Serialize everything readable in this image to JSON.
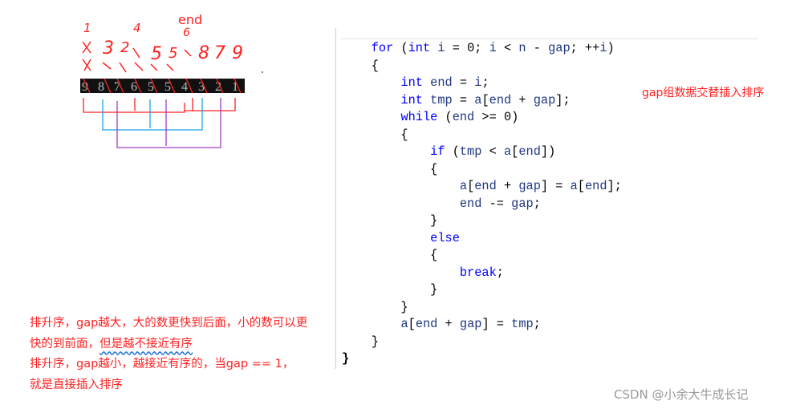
{
  "sketch": {
    "end_label": "end",
    "top_marks": [
      "1",
      "4",
      "6"
    ],
    "row1": [
      "3",
      "2",
      "5",
      "5",
      "8",
      "7",
      "9"
    ],
    "array": [
      "9",
      "8",
      "7",
      "6",
      "5",
      "5",
      "4",
      "3",
      "2",
      "1"
    ],
    "colors": {
      "red": "#ff2020",
      "blue": "#1aa3e8",
      "purple": "#a040c0"
    }
  },
  "code": {
    "lines": [
      "for (int i = 0; i < n - gap; ++i)",
      "{",
      "    int end = i;",
      "    int tmp = a[end + gap];",
      "    while (end >= 0)",
      "    {",
      "        if (tmp < a[end])",
      "        {",
      "            a[end + gap] = a[end];",
      "            end -= gap;",
      "        }",
      "        else",
      "        {",
      "            break;",
      "        }",
      "    }",
      "    a[end + gap] = tmp;",
      "}"
    ],
    "closing": "}"
  },
  "annotation": "gap组数据交替插入排序",
  "notes": {
    "line1": "排升序，gap越大，大的数更快到后面，小的数可以更",
    "line2_a": "快的到前面，",
    "line2_b": "但是越不接近有序",
    "line3": "排升序，gap越小，越接近有序的，当gap == 1，",
    "line4": "就是直接插入排序"
  },
  "watermark": "CSDN @小余大牛成长记"
}
